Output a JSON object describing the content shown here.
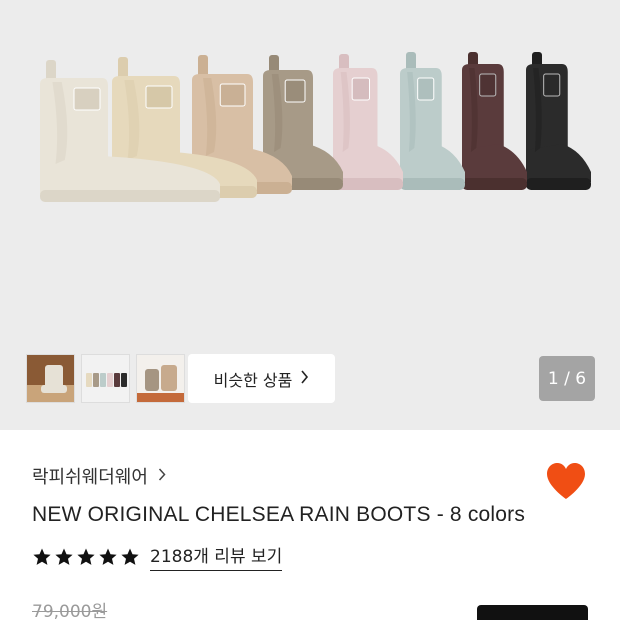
{
  "gallery": {
    "boot_colors": [
      {
        "name": "cream",
        "body": "#e9e4d8",
        "sole": "#dcd6c8",
        "label": "#d8d0c0"
      },
      {
        "name": "butter",
        "body": "#e6d9bc",
        "sole": "#dccdae",
        "label": "#d6c8a8"
      },
      {
        "name": "sand",
        "body": "#d8bfa5",
        "sole": "#cbb093",
        "label": "#c9b095"
      },
      {
        "name": "taupe",
        "body": "#a79a87",
        "sole": "#978a77",
        "label": "#9a8d7a"
      },
      {
        "name": "pink",
        "body": "#e5cfd0",
        "sole": "#d8bec0",
        "label": "#d5bcbe"
      },
      {
        "name": "mint",
        "body": "#bcccca",
        "sole": "#aabcba",
        "label": "#aebfbd"
      },
      {
        "name": "burgundy",
        "body": "#5a3b3c",
        "sole": "#4b302f",
        "label": "#4f3334"
      },
      {
        "name": "black",
        "body": "#2b2b2b",
        "sole": "#1f1f1f",
        "label": "#2a2a2a"
      }
    ],
    "similar_products_label": "비슷한 상품",
    "pager_text": "1 / 6",
    "thumb_colors": [
      "#b88a5a",
      "#d7d7d7",
      "#c6a98a"
    ]
  },
  "product": {
    "brand": "락피쉬웨더웨어",
    "title": "NEW ORIGINAL CHELSEA RAIN BOOTS - 8 colors",
    "stars": 5,
    "review_text": "2188개 리뷰 보기",
    "original_price": "79,000원"
  },
  "colors": {
    "heart": "#f04e14",
    "star": "#111111",
    "buy_button": "#111111"
  }
}
